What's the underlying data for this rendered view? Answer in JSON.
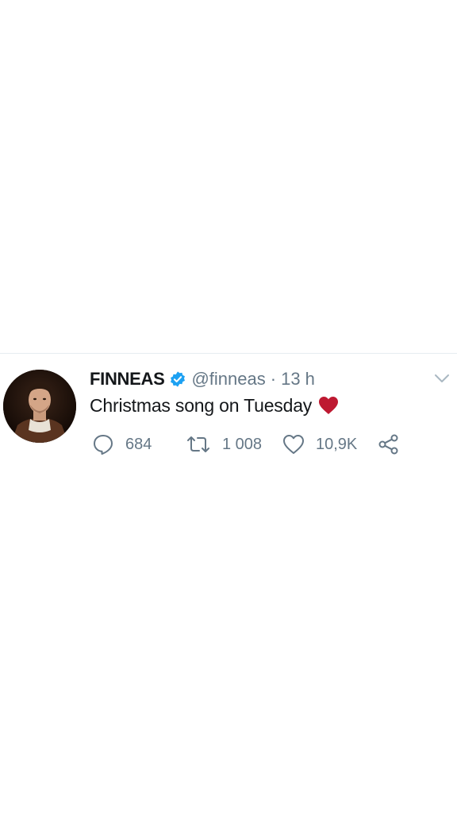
{
  "tweet": {
    "author": {
      "display_name": "FINNEAS",
      "handle": "@finneas",
      "verified": true,
      "avatar_icon": "profile-photo"
    },
    "separator": "·",
    "time": "13 h",
    "text": "Christmas song on Tuesday",
    "emoji": "red-heart-icon",
    "stats": {
      "replies": "684",
      "retweets": "1 008",
      "likes": "10,9K"
    }
  },
  "colors": {
    "text_primary": "#14171a",
    "text_secondary": "#657786",
    "verified_blue": "#1da1f2",
    "heart_red": "#be1931",
    "divider": "#e6ecf0"
  }
}
